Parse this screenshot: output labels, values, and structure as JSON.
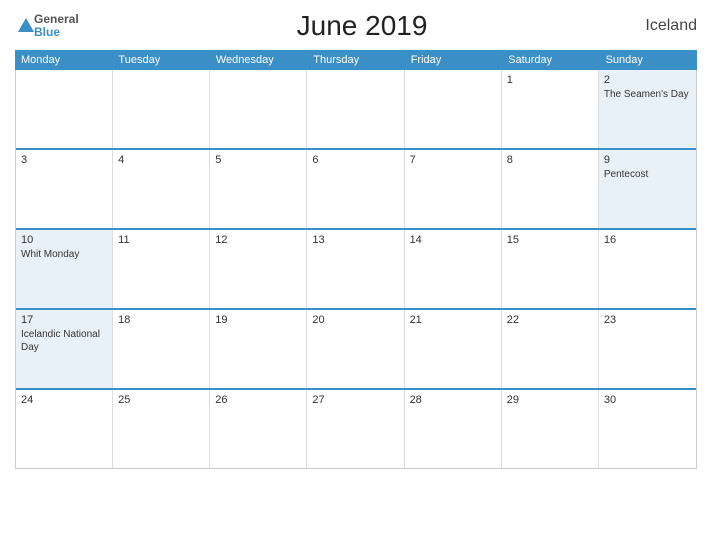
{
  "header": {
    "logo": {
      "general": "General",
      "blue": "Blue"
    },
    "title": "June 2019",
    "country": "Iceland"
  },
  "days": [
    "Monday",
    "Tuesday",
    "Wednesday",
    "Thursday",
    "Friday",
    "Saturday",
    "Sunday"
  ],
  "weeks": [
    [
      {
        "day": "",
        "holiday": ""
      },
      {
        "day": "",
        "holiday": ""
      },
      {
        "day": "",
        "holiday": ""
      },
      {
        "day": "",
        "holiday": ""
      },
      {
        "day": "",
        "holiday": ""
      },
      {
        "day": "1",
        "holiday": ""
      },
      {
        "day": "2",
        "holiday": "The Seamen's Day"
      }
    ],
    [
      {
        "day": "3",
        "holiday": ""
      },
      {
        "day": "4",
        "holiday": ""
      },
      {
        "day": "5",
        "holiday": ""
      },
      {
        "day": "6",
        "holiday": ""
      },
      {
        "day": "7",
        "holiday": ""
      },
      {
        "day": "8",
        "holiday": ""
      },
      {
        "day": "9",
        "holiday": "Pentecost"
      }
    ],
    [
      {
        "day": "10",
        "holiday": "Whit Monday"
      },
      {
        "day": "11",
        "holiday": ""
      },
      {
        "day": "12",
        "holiday": ""
      },
      {
        "day": "13",
        "holiday": ""
      },
      {
        "day": "14",
        "holiday": ""
      },
      {
        "day": "15",
        "holiday": ""
      },
      {
        "day": "16",
        "holiday": ""
      }
    ],
    [
      {
        "day": "17",
        "holiday": "Icelandic National Day"
      },
      {
        "day": "18",
        "holiday": ""
      },
      {
        "day": "19",
        "holiday": ""
      },
      {
        "day": "20",
        "holiday": ""
      },
      {
        "day": "21",
        "holiday": ""
      },
      {
        "day": "22",
        "holiday": ""
      },
      {
        "day": "23",
        "holiday": ""
      }
    ],
    [
      {
        "day": "24",
        "holiday": ""
      },
      {
        "day": "25",
        "holiday": ""
      },
      {
        "day": "26",
        "holiday": ""
      },
      {
        "day": "27",
        "holiday": ""
      },
      {
        "day": "28",
        "holiday": ""
      },
      {
        "day": "29",
        "holiday": ""
      },
      {
        "day": "30",
        "holiday": ""
      }
    ]
  ]
}
